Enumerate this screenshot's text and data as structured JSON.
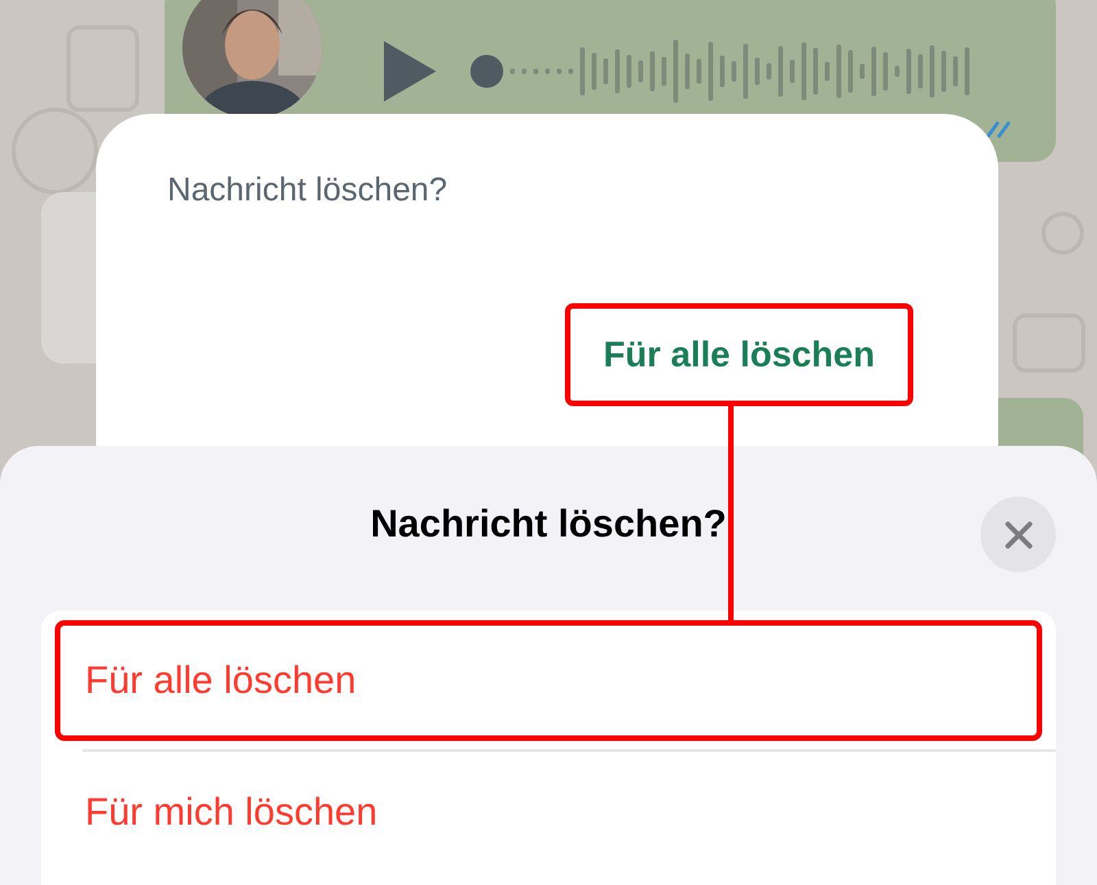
{
  "chat": {
    "voice_message": {
      "read": true
    }
  },
  "android_dialog": {
    "title": "Nachricht löschen?",
    "buttons": [
      {
        "label": "Für alle löschen",
        "highlighted": true
      }
    ]
  },
  "ios_sheet": {
    "title": "Nachricht löschen?",
    "options": [
      {
        "label": "Für alle löschen",
        "highlighted": true
      },
      {
        "label": "Für mich löschen",
        "highlighted": false
      }
    ]
  }
}
